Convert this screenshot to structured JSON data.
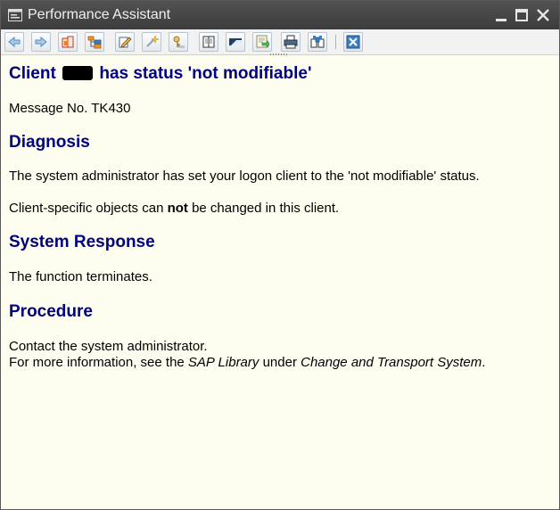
{
  "window": {
    "title": "Performance Assistant"
  },
  "toolbar": {
    "buttons": [
      {
        "icon": "arrow-left-icon"
      },
      {
        "icon": "arrow-right-icon"
      },
      {
        "icon": "book-icon"
      },
      {
        "icon": "structure-icon"
      },
      {
        "icon": "edit-icon"
      },
      {
        "icon": "magic-icon"
      },
      {
        "icon": "key-icon"
      },
      {
        "icon": "document-icon"
      },
      {
        "icon": "flag-icon"
      },
      {
        "icon": "export-icon"
      },
      {
        "icon": "print-icon"
      },
      {
        "icon": "find-icon"
      },
      {
        "icon": "close-box-icon"
      }
    ]
  },
  "content": {
    "heading_prefix": "Client",
    "heading_suffix": "has status 'not modifiable'",
    "message_no": "Message No. TK430",
    "diagnosis": {
      "title": "Diagnosis",
      "p1": "The system administrator has set your logon client to the 'not modifiable' status.",
      "p2_before": "Client-specific objects can ",
      "p2_bold": "not",
      "p2_after": " be changed in this client."
    },
    "system_response": {
      "title": "System Response",
      "text": "The function terminates."
    },
    "procedure": {
      "title": "Procedure",
      "line1": "Contact the system administrator.",
      "line2_before": "For more information, see the ",
      "line2_italic1": "SAP Library",
      "line2_mid": " under ",
      "line2_italic2": "Change and Transport System",
      "line2_after": "."
    }
  }
}
